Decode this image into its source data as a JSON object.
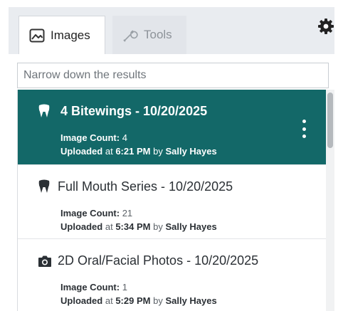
{
  "tabs": [
    {
      "label": "Images",
      "icon": "image-icon",
      "active": true
    },
    {
      "label": "Tools",
      "icon": "wrench-icon",
      "active": false
    }
  ],
  "settings_icon": "gear-icon",
  "search": {
    "placeholder": "Narrow down the results",
    "value": ""
  },
  "items": [
    {
      "icon": "tooth-icon",
      "title": "4 Bitewings - 10/20/2025",
      "count_label": "Image Count:",
      "count": "4",
      "uploaded_label": "Uploaded",
      "at_text": "at",
      "time": "6:21 PM",
      "by_text": "by",
      "user": "Sally Hayes",
      "selected": true
    },
    {
      "icon": "tooth-icon",
      "title": "Full Mouth Series - 10/20/2025",
      "count_label": "Image Count:",
      "count": "21",
      "uploaded_label": "Uploaded",
      "at_text": "at",
      "time": "5:34 PM",
      "by_text": "by",
      "user": "Sally Hayes",
      "selected": false
    },
    {
      "icon": "camera-icon",
      "title": "2D Oral/Facial Photos - 10/20/2025",
      "count_label": "Image Count:",
      "count": "1",
      "uploaded_label": "Uploaded",
      "at_text": "at",
      "time": "5:29 PM",
      "by_text": "by",
      "user": "Sally Hayes",
      "selected": false
    }
  ],
  "colors": {
    "selected_bg": "#136868",
    "tab_bar_bg": "#e9ecf0"
  }
}
